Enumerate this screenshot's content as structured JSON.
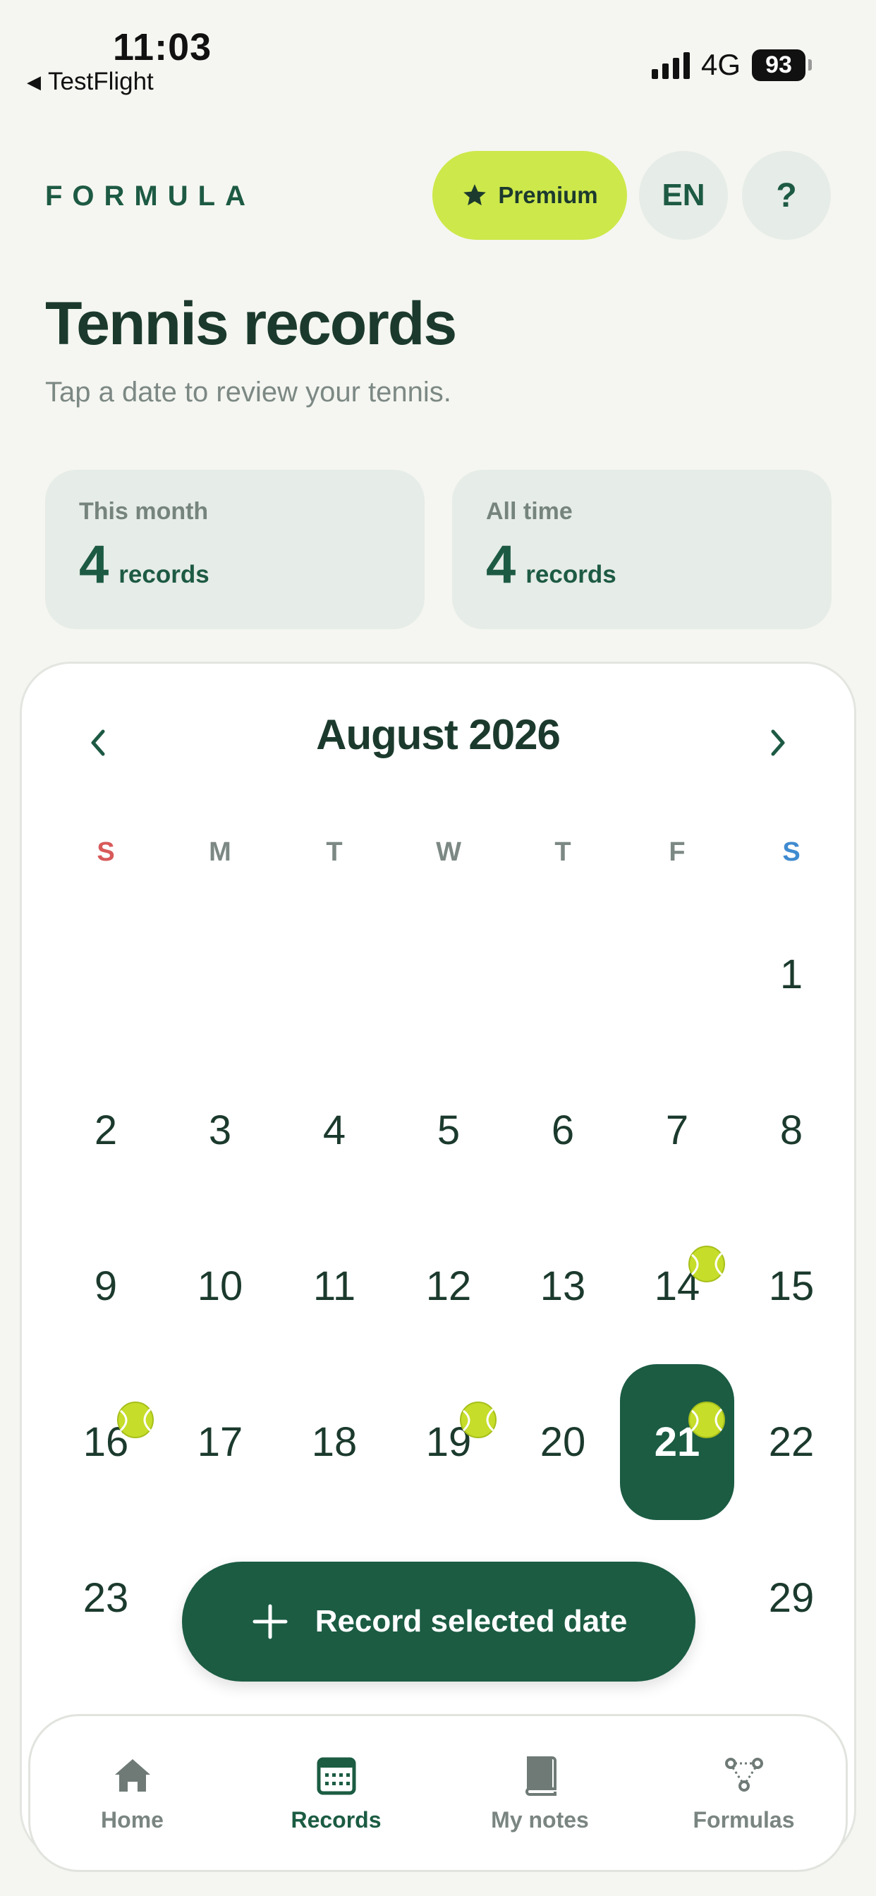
{
  "status_bar": {
    "time": "11:03",
    "back_label": "TestFlight",
    "network": "4G",
    "battery": "93"
  },
  "header": {
    "brand": "FORMULA",
    "premium_label": "Premium",
    "language": "EN",
    "help": "?"
  },
  "page": {
    "title": "Tennis records",
    "subtitle": "Tap a date to review your tennis."
  },
  "stats": [
    {
      "label": "This month",
      "value": "4",
      "unit": "records"
    },
    {
      "label": "All time",
      "value": "4",
      "unit": "records"
    }
  ],
  "calendar": {
    "month_title": "August 2026",
    "weekdays": [
      "S",
      "M",
      "T",
      "W",
      "T",
      "F",
      "S"
    ],
    "days": [
      "1",
      "2",
      "3",
      "4",
      "5",
      "6",
      "7",
      "8",
      "9",
      "10",
      "11",
      "12",
      "13",
      "14",
      "15",
      "16",
      "17",
      "18",
      "19",
      "20",
      "21",
      "22",
      "23",
      "29"
    ],
    "selected_day": "21",
    "recorded_days": [
      "14",
      "16",
      "19",
      "21"
    ]
  },
  "action": {
    "record_label": "Record selected date"
  },
  "tabs": [
    {
      "label": "Home",
      "icon": "house-icon",
      "active": false
    },
    {
      "label": "Records",
      "icon": "calendar-icon",
      "active": true
    },
    {
      "label": "My notes",
      "icon": "book-icon",
      "active": false
    },
    {
      "label": "Formulas",
      "icon": "formation-icon",
      "active": false
    }
  ],
  "colors": {
    "primary": "#1b5c43",
    "accent": "#cde84a",
    "background": "#f5f6f1",
    "sunday": "#d85a5a",
    "saturday": "#3f8bd0"
  }
}
